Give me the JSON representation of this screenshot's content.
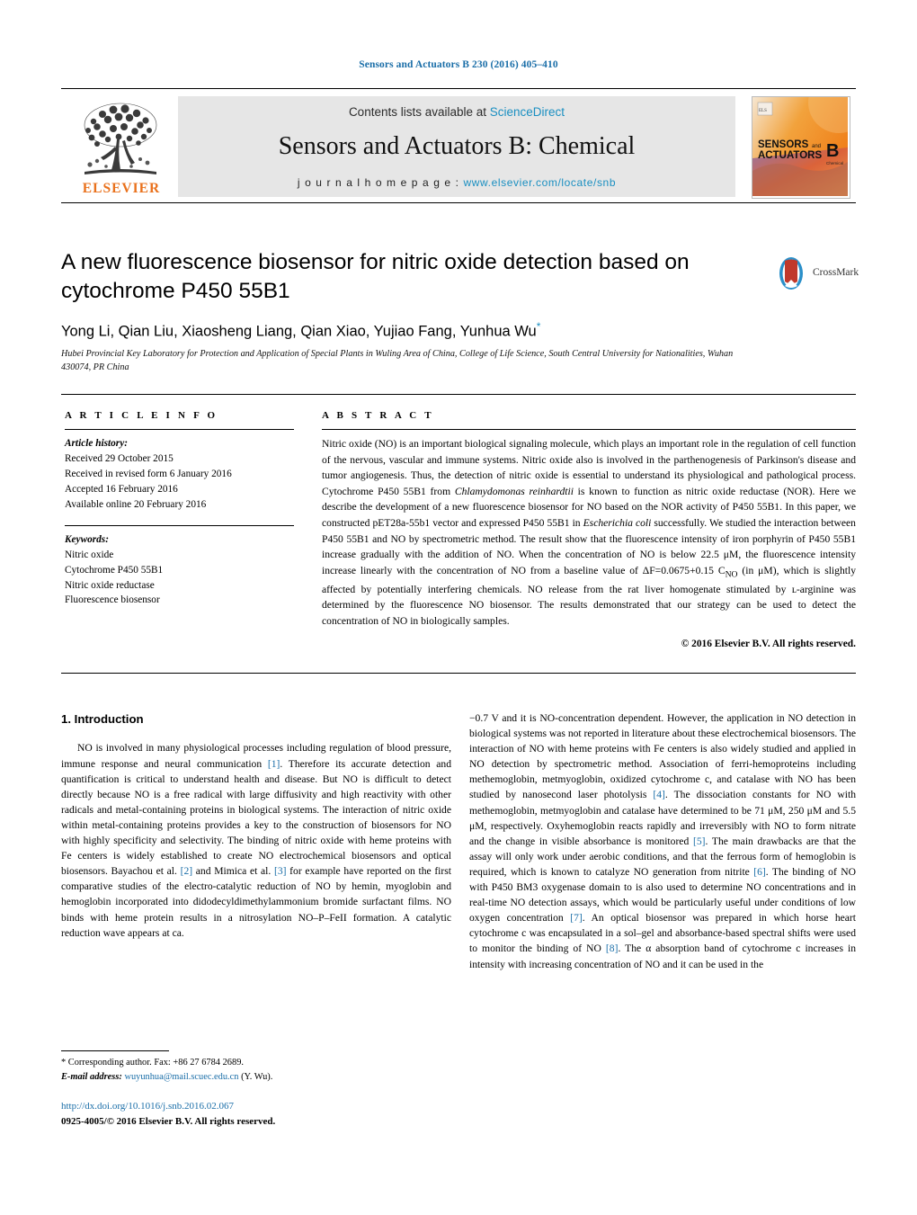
{
  "running_head": "Sensors and Actuators B 230 (2016) 405–410",
  "masthead": {
    "contents_prefix": "Contents lists available at ",
    "sciencedirect": "ScienceDirect",
    "journal_title": "Sensors and Actuators B: Chemical",
    "homepage_prefix": "j o u r n a l   h o m e p a g e :   ",
    "homepage_url": "www.elsevier.com/locate/snb",
    "publisher": "ELSEVIER",
    "cover": {
      "line1": "SENSORS",
      "line1_sub": "and",
      "line2": "ACTUATORS",
      "volume_letter": "B",
      "volume_sub": "Chemical"
    },
    "colors": {
      "elsevier_orange": "#E9711C",
      "link_blue": "#1a8fc1",
      "panel_gray": "#e6e6e6"
    }
  },
  "crossmark": {
    "label": "CrossMark"
  },
  "article": {
    "title": "A new fluorescence biosensor for nitric oxide detection based on cytochrome P450 55B1",
    "authors": "Yong Li, Qian Liu, Xiaosheng Liang, Qian Xiao, Yujiao Fang, Yunhua Wu",
    "corresponding_marker": "*",
    "affiliation": "Hubei Provincial Key Laboratory for Protection and Application of Special Plants in Wuling Area of China, College of Life Science, South Central University for Nationalities, Wuhan 430074, PR China"
  },
  "article_info": {
    "heading": "A R T I C L E   I N F O",
    "history_label": "Article history:",
    "history": [
      "Received 29 October 2015",
      "Received in revised form 6 January 2016",
      "Accepted 16 February 2016",
      "Available online 20 February 2016"
    ],
    "keywords_label": "Keywords:",
    "keywords": [
      "Nitric oxide",
      "Cytochrome P450 55B1",
      "Nitric oxide reductase",
      "Fluorescence biosensor"
    ]
  },
  "abstract": {
    "heading": "A B S T R A C T",
    "part1": "Nitric oxide (NO) is an important biological signaling molecule, which plays an important role in the regulation of cell function of the nervous, vascular and immune systems. Nitric oxide also is involved in the parthenogenesis of Parkinson's disease and tumor angiogenesis. Thus, the detection of nitric oxide is essential to understand its physiological and pathological process. Cytochrome P450 55B1 from ",
    "italic1": "Chlamydomonas reinhardtii",
    "part2": " is known to function as nitric oxide reductase (NOR). Here we describe the development of a new fluorescence biosensor for NO based on the NOR activity of P450 55B1. In this paper, we constructed pET28a-55b1 vector and expressed P450 55B1 in ",
    "italic2": "Escherichia coli",
    "part3": " successfully. We studied the interaction between P450 55B1 and NO by spectrometric method. The result show that the fluorescence intensity of iron porphyrin of P450 55B1 increase gradually with the addition of NO. When the concentration of NO is below 22.5 μM, the fluorescence intensity increase linearly with the concentration of NO from a baseline value of ΔF=0.0675+0.15 C",
    "sub1": "NO",
    "part4": " (in μM), which is slightly affected by potentially interfering chemicals. NO release from the rat liver homogenate stimulated by ʟ-arginine was determined by the fluorescence NO biosensor. The results demonstrated that our strategy can be used to detect the concentration of NO in biologically samples.",
    "copyright": "© 2016 Elsevier B.V. All rights reserved."
  },
  "body": {
    "section_number_title": "1.  Introduction",
    "left_part1": "NO is involved in many physiological processes including regulation of blood pressure, immune response and neural communication ",
    "ref1": "[1]",
    "left_part2": ". Therefore its accurate detection and quantification is critical to understand health and disease. But NO is difficult to detect directly because NO is a free radical with large diffusivity and high reactivity with other radicals and metal-containing proteins in biological systems. The interaction of nitric oxide within metal-containing proteins provides a key to the construction of biosensors for NO with highly specificity and selectivity. The binding of nitric oxide with heme proteins with Fe centers is widely established to create NO electrochemical biosensors and optical biosensors. Bayachou et al. ",
    "ref2": "[2]",
    "left_part3": " and Mimica et al. ",
    "ref3": "[3]",
    "left_part4": " for example have reported on the first comparative studies of the electro-catalytic reduction of NO by hemin, myoglobin and hemoglobin incorporated into didodecyldimethylammonium bromide surfactant films. NO binds with heme protein results in a nitrosylation NO–P–FeII formation. A catalytic reduction wave appears at ca.",
    "right_part1": "−0.7 V and it is NO-concentration dependent. However, the application in NO detection in biological systems was not reported in literature about these electrochemical biosensors. The interaction of NO with heme proteins with Fe centers is also widely studied and applied in NO detection by spectrometric method. Association of ferri-hemoproteins including methemoglobin, metmyoglobin, oxidized cytochrome c, and catalase with NO has been studied by nanosecond laser photolysis ",
    "ref4": "[4]",
    "right_part2": ". The dissociation constants for NO with methemoglobin, metmyoglobin and catalase have determined to be 71 μM, 250 μM and 5.5 μM, respectively. Oxyhemoglobin reacts rapidly and irreversibly with NO to form nitrate and the change in visible absorbance is monitored ",
    "ref5": "[5]",
    "right_part3": ". The main drawbacks are that the assay will only work under aerobic conditions, and that the ferrous form of hemoglobin is required, which is known to catalyze NO generation from nitrite ",
    "ref6": "[6]",
    "right_part4": ". The binding of NO with P450 BM3 oxygenase domain to is also used to determine NO concentrations and in real-time NO detection assays, which would be particularly useful under conditions of low oxygen concentration ",
    "ref7": "[7]",
    "right_part5": ". An optical biosensor was prepared in which horse heart cytochrome c was encapsulated in a sol–gel and absorbance-based spectral shifts were used to monitor the binding of NO ",
    "ref8": "[8]",
    "right_part6": ". The α absorption band of cytochrome c increases in intensity with increasing concentration of NO and it can be used in the"
  },
  "footnote": {
    "corresponding": "* Corresponding author. Fax: +86 27 6784 2689.",
    "email_label": "E-mail address:",
    "email": "wuyunhua@mail.scuec.edu.cn",
    "email_suffix": " (Y. Wu)."
  },
  "footer": {
    "doi": "http://dx.doi.org/10.1016/j.snb.2016.02.067",
    "issn_line": "0925-4005/© 2016 Elsevier B.V. All rights reserved."
  }
}
